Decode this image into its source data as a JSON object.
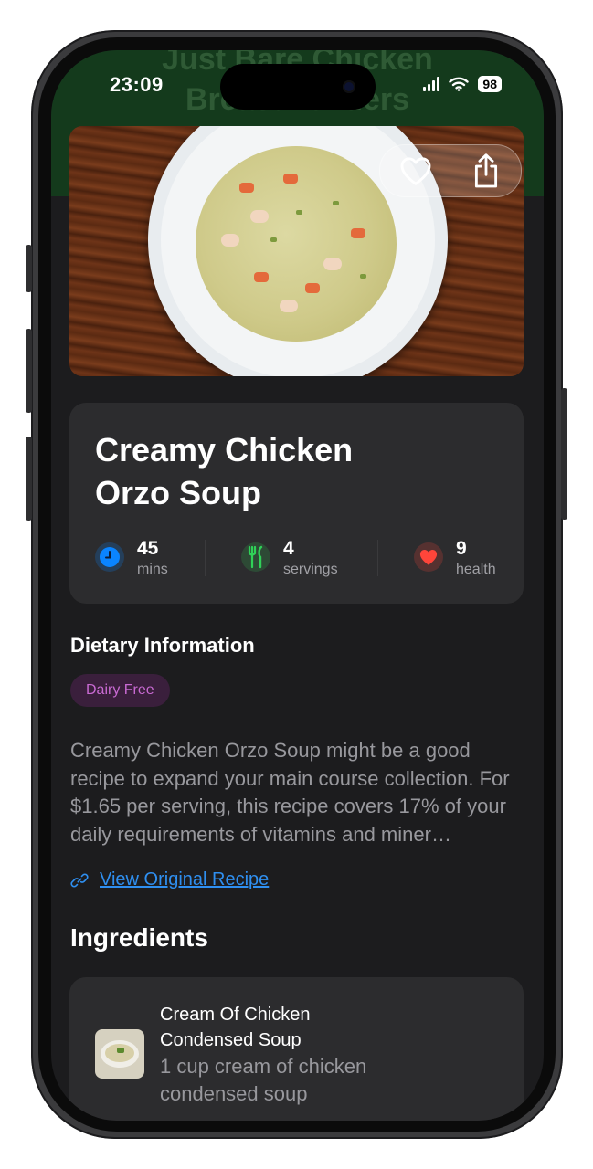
{
  "status_bar": {
    "time": "23:09",
    "battery": "98"
  },
  "nav": {
    "title_line1": "Just Bare Chicken",
    "title_line2": "Breast Tenders"
  },
  "recipe": {
    "title": "Creamy Chicken Orzo Soup",
    "stats": [
      {
        "value": "45",
        "unit": "mins",
        "icon": "clock-icon",
        "color": "#0a84ff"
      },
      {
        "value": "4",
        "unit": "servings",
        "icon": "fork-knife-icon",
        "color": "#30d158"
      },
      {
        "value": "9",
        "unit": "health",
        "icon": "heart-icon",
        "color": "#ff453a"
      }
    ]
  },
  "dietary": {
    "heading": "Dietary Information",
    "badges": [
      "Dairy Free"
    ]
  },
  "summary": "Creamy Chicken Orzo Soup might be a good recipe to expand your main course collection. For $1.65 per serving, this recipe covers 17% of your daily requirements of vitamins and miner…",
  "link": {
    "label": "View Original Recipe"
  },
  "ingredients": {
    "heading": "Ingredients",
    "items": [
      {
        "name": "Cream Of Chicken Condensed Soup",
        "amount": "1 cup cream of chicken condensed soup"
      }
    ]
  },
  "colors": {
    "background": "#1c1c1e",
    "card": "#2c2c2e",
    "nav": "#143a1c",
    "link": "#2f8ff0",
    "badge_text": "#c86ad2"
  }
}
